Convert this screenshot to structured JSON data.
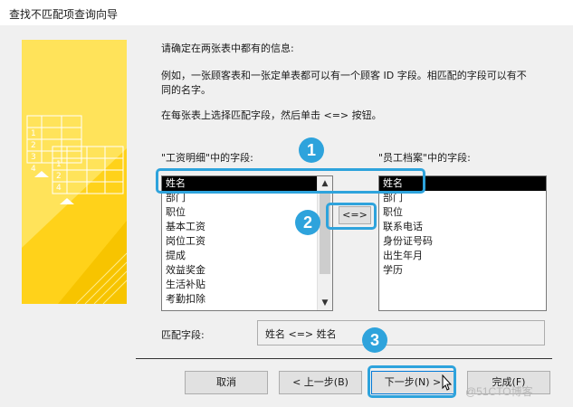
{
  "window": {
    "title": "查找不匹配项查询向导"
  },
  "instructions": {
    "line1": "请确定在两张表中都有的信息:",
    "line2a": "例如，一张顾客表和一张定单表都可以有一个顾客 ID 字段。相匹配的字段可以有不",
    "line2b": "同的名字。",
    "line3": "在每张表上选择匹配字段，然后单击 <=> 按钮。"
  },
  "left_list": {
    "label": "\"工资明细\"中的字段:",
    "items": [
      "姓名",
      "部门",
      "职位",
      "基本工资",
      "岗位工资",
      "提成",
      "效益奖金",
      "生活补贴",
      "考勤扣除"
    ],
    "selected_index": 0
  },
  "right_list": {
    "label": "\"员工档案\"中的字段:",
    "items": [
      "姓名",
      "部门",
      "职位",
      "联系电话",
      "身份证号码",
      "出生年月",
      "学历"
    ],
    "selected_index": 0
  },
  "match_button": {
    "label": "<=>"
  },
  "match_field": {
    "label": "匹配字段:",
    "value": "姓名 <=> 姓名"
  },
  "buttons": {
    "cancel": "取消",
    "back": "< 上一步(B)",
    "next": "下一步(N) >",
    "finish": "完成(F)"
  },
  "callouts": {
    "one": "1",
    "two": "2",
    "three": "3"
  },
  "wizard_art": {
    "rows_back": [
      "1",
      "2",
      "3",
      "4"
    ],
    "rows_front": [
      "1",
      "2",
      "4"
    ]
  },
  "watermark": "@51CTO博客",
  "colors": {
    "accent": "#2ea3dc",
    "art_yellow": "#ffd21a",
    "selection": "#000000"
  }
}
